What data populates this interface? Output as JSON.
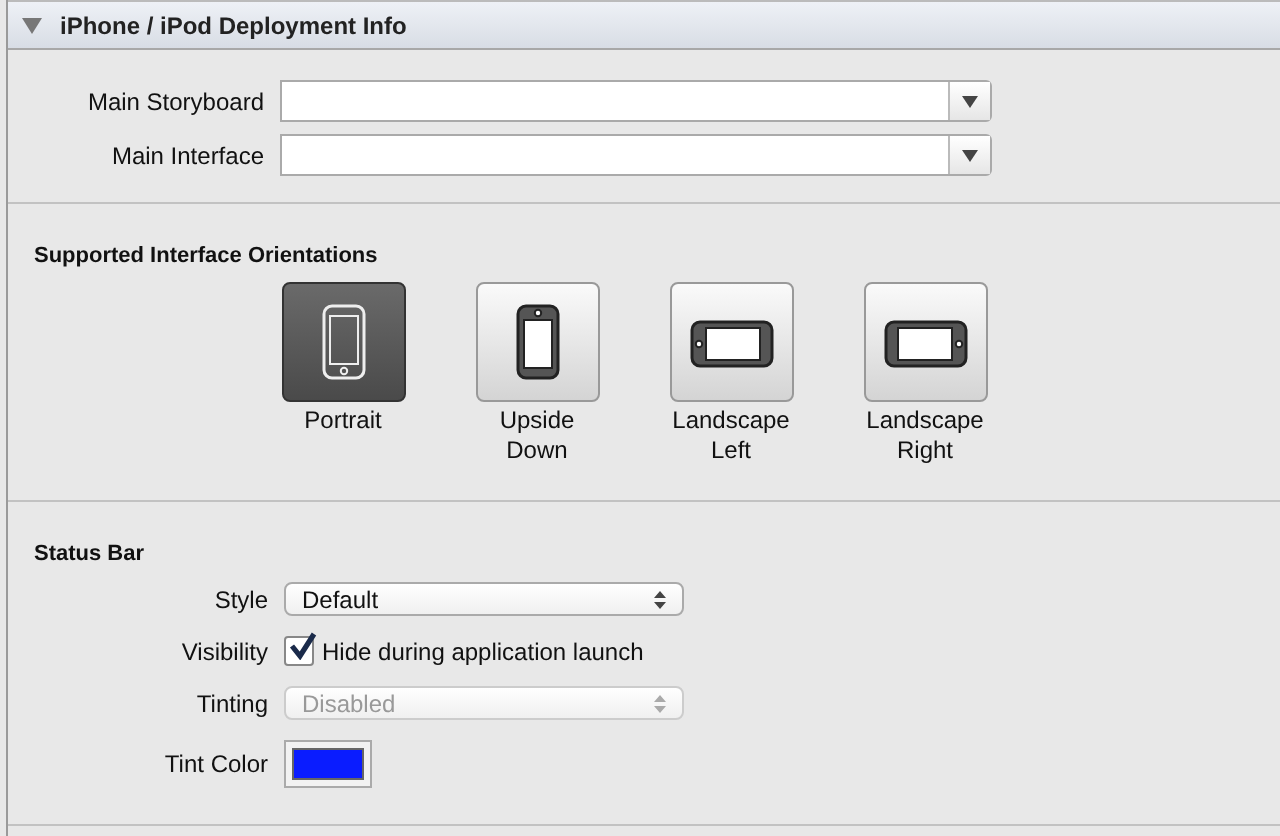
{
  "section": {
    "title": "iPhone / iPod Deployment Info",
    "expanded": true
  },
  "main_fields": [
    {
      "label": "Main Storyboard"
    },
    {
      "label": "Main Interface"
    }
  ],
  "orientations": {
    "title": "Supported Interface Orientations",
    "items": [
      {
        "kind": "portrait",
        "label": "Portrait",
        "selected": true
      },
      {
        "kind": "upside_down",
        "label": "Upside\nDown",
        "selected": false
      },
      {
        "kind": "landscape_left",
        "label": "Landscape\nLeft",
        "selected": false
      },
      {
        "kind": "landscape_right",
        "label": "Landscape\nRight",
        "selected": false
      }
    ]
  },
  "status_bar": {
    "title": "Status Bar",
    "style": {
      "label": "Style",
      "value": "Default",
      "disabled": false
    },
    "visibility": {
      "label": "Visibility",
      "checkbox_label": "Hide during application launch",
      "checked": true
    },
    "tinting": {
      "label": "Tinting",
      "value": "Disabled",
      "disabled": true
    },
    "tint_color": {
      "label": "Tint Color",
      "color": "#0a1cff"
    }
  }
}
